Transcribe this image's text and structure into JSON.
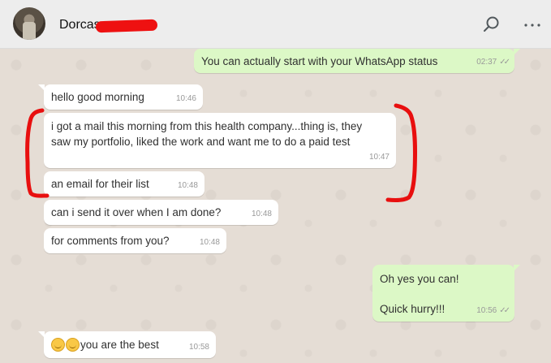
{
  "header": {
    "contact_name": "Dorcas",
    "icons": [
      "search-icon",
      "menu-icon"
    ]
  },
  "messages": [
    {
      "dir": "out",
      "text": "You can actually start with your WhatsApp status",
      "time": "02:37",
      "status": "read-double-check"
    },
    {
      "dir": "in",
      "text": "hello good morning",
      "time": "10:46"
    },
    {
      "dir": "in",
      "lines": [
        "i got a mail this morning from this health company...thing is, they",
        "saw my portfolio, liked the work and want me to do a paid test"
      ],
      "time": "10:47"
    },
    {
      "dir": "in",
      "text": "an email for their list",
      "time": "10:48"
    },
    {
      "dir": "in",
      "text": "can i send it over when I am done?",
      "time": "10:48"
    },
    {
      "dir": "in",
      "text": "for comments from you?",
      "time": "10:48"
    },
    {
      "dir": "out",
      "lines": [
        "Oh yes you can!",
        "",
        "Quick hurry!!!"
      ],
      "time": "10:56",
      "status": "read-double-check"
    },
    {
      "dir": "in",
      "emojis": [
        "smiling-face-emoji",
        "smiling-face-emoji"
      ],
      "text": "you are the best",
      "time": "10:58"
    }
  ],
  "colors": {
    "chat_background": "#e5ddd5",
    "outgoing_bubble": "#dcf8c6",
    "incoming_bubble": "#ffffff",
    "annotation_red": "#e80f0f"
  }
}
